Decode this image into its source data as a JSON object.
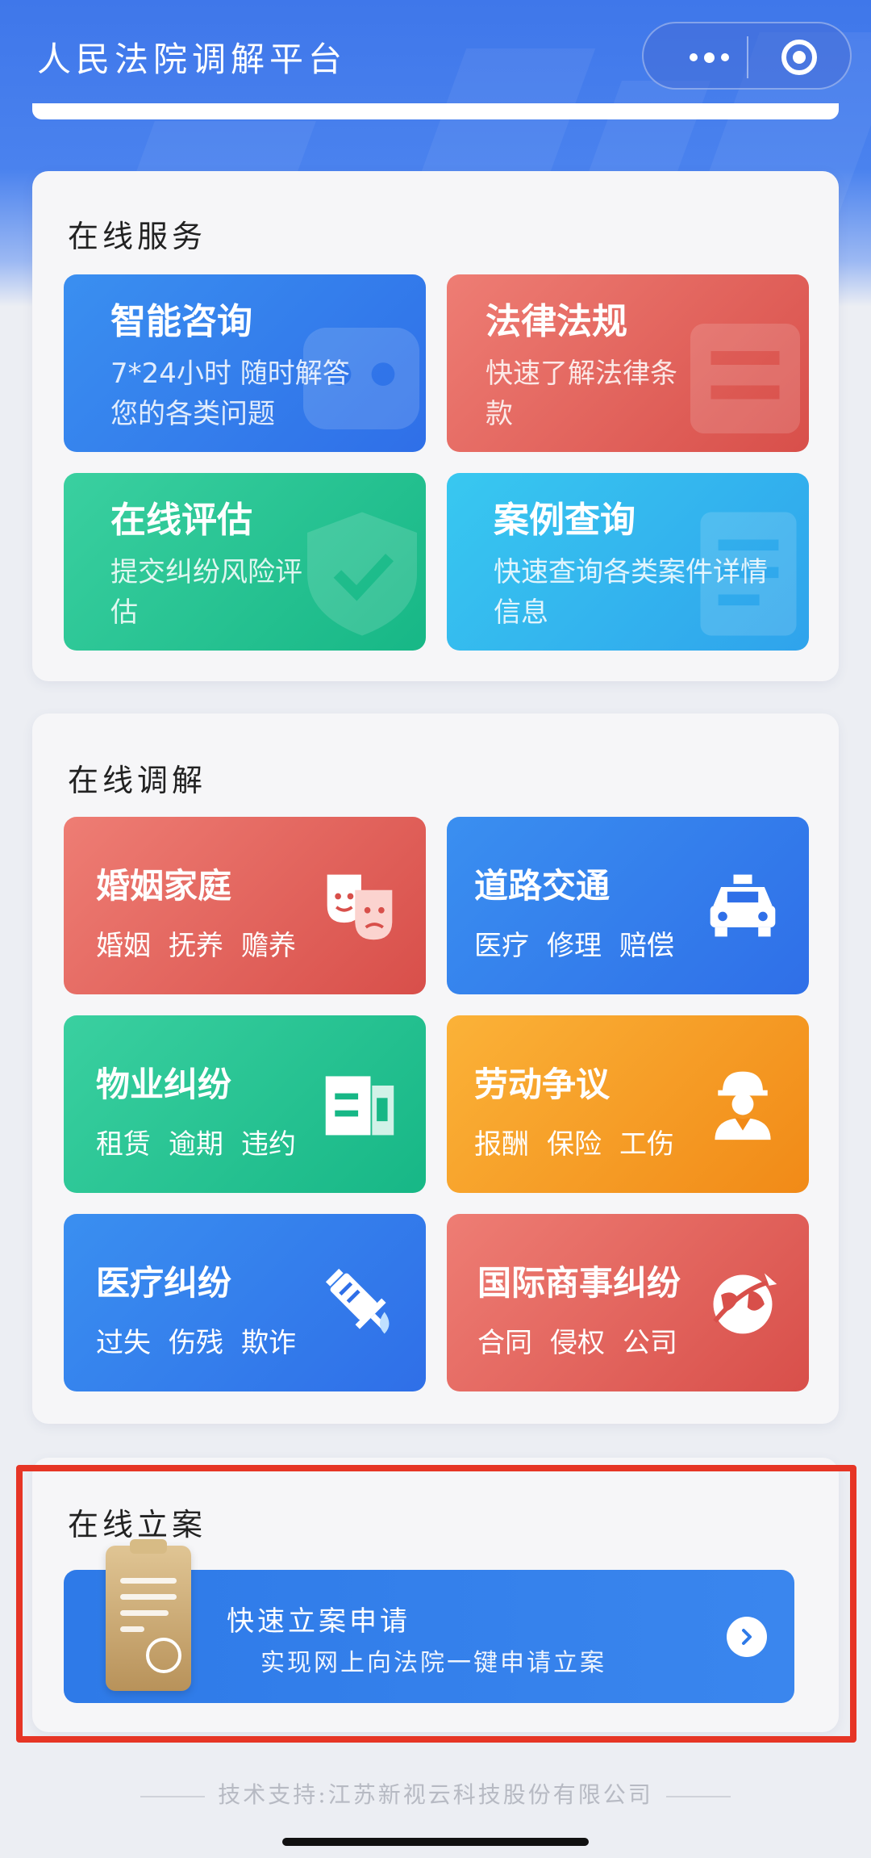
{
  "header": {
    "title": "人民法院调解平台"
  },
  "online_services": {
    "title": "在线服务",
    "tiles": [
      {
        "title": "智能咨询",
        "desc": "7*24小时 随时解答您的各类问题",
        "color": "#3a8ff0"
      },
      {
        "title": "法律法规",
        "desc": "快速了解法律条款",
        "color": "#ee7d74"
      },
      {
        "title": "在线评估",
        "desc": "提交纠纷风险评估",
        "color": "#3ad0a0"
      },
      {
        "title": "案例查询",
        "desc": "快速查询各类案件详情信息",
        "color": "#38c8f0"
      }
    ]
  },
  "online_mediation": {
    "title": "在线调解",
    "tiles": [
      {
        "title": "婚姻家庭",
        "tags": [
          "婚姻",
          "抚养",
          "赡养"
        ],
        "icon": "theater-masks-icon",
        "color": "#ee7d74"
      },
      {
        "title": "道路交通",
        "tags": [
          "医疗",
          "修理",
          "赔偿"
        ],
        "icon": "taxi-icon",
        "color": "#3a8ff0"
      },
      {
        "title": "物业纠纷",
        "tags": [
          "租赁",
          "逾期",
          "违约"
        ],
        "icon": "building-icon",
        "color": "#3ad0a0"
      },
      {
        "title": "劳动争议",
        "tags": [
          "报酬",
          "保险",
          "工伤"
        ],
        "icon": "worker-icon",
        "color": "#fbb238"
      },
      {
        "title": "医疗纠纷",
        "tags": [
          "过失",
          "伤残",
          "欺诈"
        ],
        "icon": "syringe-icon",
        "color": "#3a8ff0"
      },
      {
        "title": "国际商事纠纷",
        "tags": [
          "合同",
          "侵权",
          "公司"
        ],
        "icon": "globe-plane-icon",
        "color": "#ee7d74"
      }
    ]
  },
  "online_filing": {
    "title": "在线立案",
    "banner_title": "快速立案申请",
    "banner_subtitle": "实现网上向法院一键申请立案",
    "icon": "clipboard-globe-icon"
  },
  "footer": {
    "text": "技术支持:江苏新视云科技股份有限公司"
  },
  "colors": {
    "primary": "#3a7bea",
    "highlight": "#e63525"
  }
}
